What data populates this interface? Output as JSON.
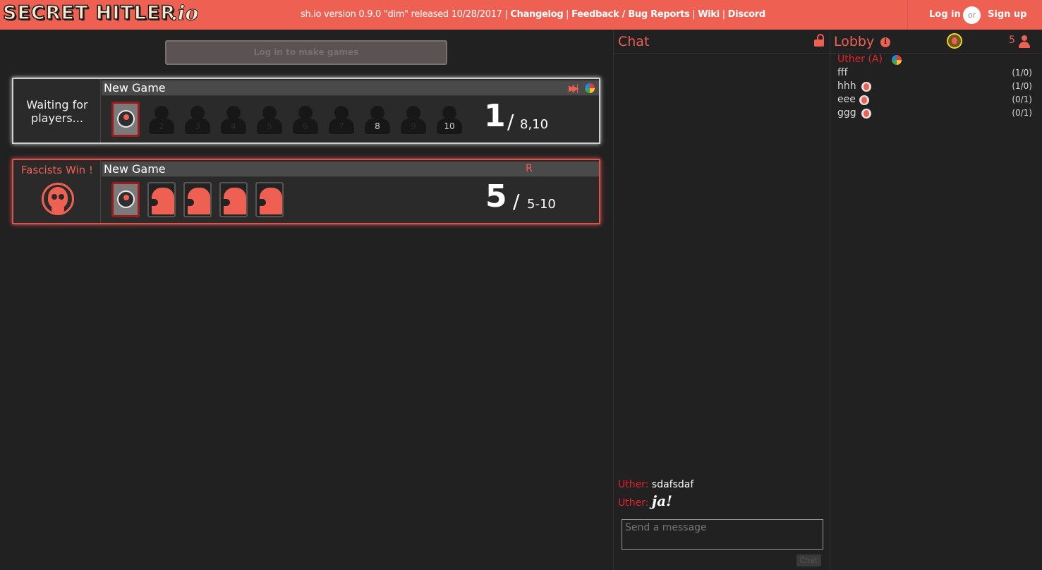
{
  "header": {
    "logo_text": "SECRET HITLER",
    "logo_suffix": ".io",
    "version_text": "sh.io version 0.9.0 \"dim\" released 10/28/2017 | ",
    "links": [
      "Changelog",
      "Feedback / Bug Reports",
      "Wiki",
      "Discord"
    ],
    "sep": " | ",
    "login": "Log in",
    "or": "or",
    "signup": "Sign up"
  },
  "make_games_button": "Log in to make games",
  "games": [
    {
      "status": "Waiting for players...",
      "name": "New Game",
      "seats_empty_labels": [
        "2",
        "3",
        "4",
        "5",
        "6",
        "7",
        "8",
        "9",
        "10"
      ],
      "count": "1",
      "slash": "/",
      "allowed": "8,10"
    },
    {
      "status": "Fascists Win !",
      "name": "New Game",
      "rebalanced": "R",
      "count": "5",
      "slash": "/",
      "allowed": "5-10"
    }
  ],
  "chat": {
    "title": "Chat",
    "messages": [
      {
        "user": "Uther:",
        "text": "sdafsdaf"
      },
      {
        "user": "Uther:",
        "text": "ja!"
      }
    ],
    "input_placeholder": "Send a message",
    "send_label": "Chat"
  },
  "lobby": {
    "title": "Lobby",
    "user_count": "5",
    "users": [
      {
        "name": "Uther (A)",
        "score": ""
      },
      {
        "name": "fff",
        "score": "(1/0)"
      },
      {
        "name": "hhh",
        "score": "(1/0)"
      },
      {
        "name": "eee",
        "score": "(0/1)"
      },
      {
        "name": "ggg",
        "score": "(0/1)"
      }
    ]
  },
  "colors": {
    "accent": "#ee6152",
    "admin_red": "#e0222a",
    "background": "#212121"
  }
}
